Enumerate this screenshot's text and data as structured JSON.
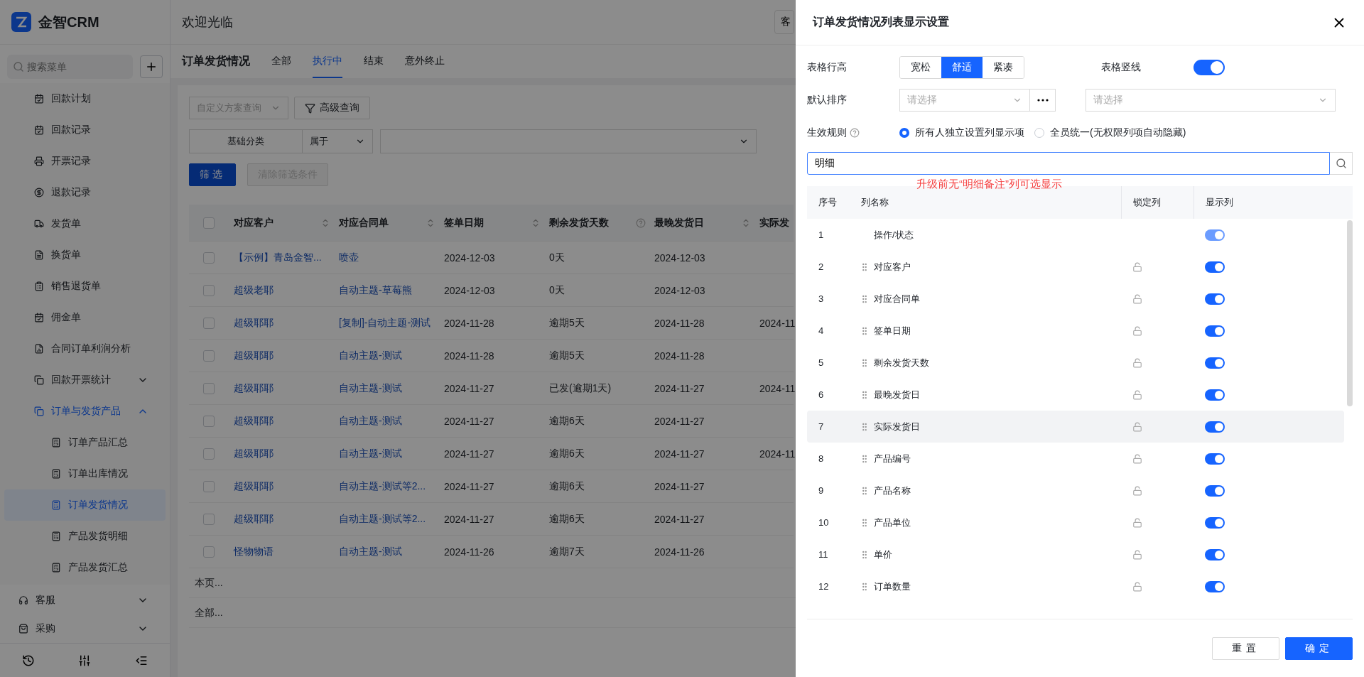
{
  "app": {
    "logo_text": "金智CRM"
  },
  "sidebar": {
    "search_placeholder": "搜索菜单",
    "sub_items": [
      {
        "label": "回款计划",
        "selected": false
      },
      {
        "label": "回款记录",
        "selected": false
      },
      {
        "label": "开票记录",
        "selected": false
      },
      {
        "label": "退款记录",
        "selected": false
      },
      {
        "label": "发货单",
        "selected": false
      },
      {
        "label": "换货单",
        "selected": false
      },
      {
        "label": "销售退货单",
        "selected": false
      },
      {
        "label": "佣金单",
        "selected": false
      },
      {
        "label": "合同订单利润分析",
        "selected": false
      },
      {
        "label": "回款开票统计",
        "expanded": false
      },
      {
        "label": "订单与发货产品",
        "expanded": true,
        "children": [
          {
            "label": "订单产品汇总",
            "selected": false
          },
          {
            "label": "订单出库情况",
            "selected": false
          },
          {
            "label": "订单发货情况",
            "selected": true
          },
          {
            "label": "产品发货明细",
            "selected": false
          },
          {
            "label": "产品发货汇总",
            "selected": false
          }
        ]
      }
    ],
    "items": [
      {
        "label": "客服",
        "expanded": false
      },
      {
        "label": "采购",
        "expanded": false
      }
    ]
  },
  "header": {
    "title": "欢迎光临",
    "button": "客"
  },
  "page": {
    "title": "订单发货情况",
    "tabs": [
      {
        "label": "全部",
        "selected": false
      },
      {
        "label": "执行中",
        "selected": true
      },
      {
        "label": "结束",
        "selected": false
      },
      {
        "label": "意外终止",
        "selected": false
      }
    ],
    "scheme_select": "自定义方案查询",
    "advanced_button": "高级查询",
    "filter": {
      "field": "基础分类",
      "operator": "属于"
    },
    "filter_button": "筛选",
    "clear_button": "清除筛选条件",
    "table": {
      "select_all": false,
      "columns": [
        {
          "label": "对应客户",
          "sortable": true,
          "help": false
        },
        {
          "label": "对应合同单",
          "sortable": true,
          "help": false
        },
        {
          "label": "签单日期",
          "sortable": true,
          "help": false
        },
        {
          "label": "剩余发货天数",
          "sortable": false,
          "help": true
        },
        {
          "label": "最晚发货日",
          "sortable": true,
          "help": false
        },
        {
          "label": "实际发"
        }
      ],
      "rows": [
        {
          "checked": false,
          "cells": [
            "【示例】青岛金智...",
            "喷壶",
            "2024-12-03",
            "0天",
            "2024-12-03",
            ""
          ]
        },
        {
          "checked": false,
          "cells": [
            "超级老耶",
            "自动主题-草莓熊",
            "2024-12-03",
            "0天",
            "2024-12-03",
            ""
          ]
        },
        {
          "checked": false,
          "cells": [
            "超级耶耶",
            "[复制]-自动主题-测试",
            "2024-11-28",
            "逾期5天",
            "2024-11-28",
            "2024-11"
          ]
        },
        {
          "checked": false,
          "cells": [
            "超级耶耶",
            "自动主题-测试",
            "2024-11-28",
            "逾期5天",
            "2024-11-28",
            ""
          ]
        },
        {
          "checked": false,
          "cells": [
            "超级耶耶",
            "自动主题-测试",
            "2024-11-27",
            "已发(逾期1天)",
            "2024-11-27",
            "2024-11"
          ]
        },
        {
          "checked": false,
          "cells": [
            "超级耶耶",
            "自动主题-测试",
            "2024-11-27",
            "逾期6天",
            "2024-11-27",
            ""
          ]
        },
        {
          "checked": false,
          "cells": [
            "超级耶耶",
            "自动主题-测试",
            "2024-11-27",
            "逾期6天",
            "2024-11-27",
            "2024-11"
          ]
        },
        {
          "checked": false,
          "cells": [
            "超级耶耶",
            "自动主题-测试等2...",
            "2024-11-27",
            "逾期6天",
            "2024-11-27",
            ""
          ]
        },
        {
          "checked": false,
          "cells": [
            "超级耶耶",
            "自动主题-测试等2...",
            "2024-11-27",
            "逾期6天",
            "2024-11-27",
            ""
          ]
        },
        {
          "checked": false,
          "cells": [
            "怪物物语",
            "自动主题-测试",
            "2024-11-26",
            "逾期7天",
            "2024-11-26",
            ""
          ]
        }
      ],
      "summary_rows": [
        "本页...",
        "全部..."
      ]
    }
  },
  "drawer": {
    "title": "订单发货情况列表显示设置",
    "row_height_label": "表格行高",
    "row_height_options": [
      {
        "label": "宽松",
        "selected": false
      },
      {
        "label": "舒适",
        "selected": true
      },
      {
        "label": "紧凑",
        "selected": false
      }
    ],
    "vertical_lines": {
      "label": "表格竖线",
      "on": true
    },
    "sort": {
      "label": "默认排序",
      "placeholder_1": "请选择",
      "placeholder_2": "请选择"
    },
    "rule": {
      "label": "生效规则",
      "options": [
        {
          "label": "所有人独立设置列显示项",
          "selected": true
        },
        {
          "label": "全员统一(无权限列项自动隐藏)",
          "selected": false
        }
      ]
    },
    "search_value": "明细",
    "annotation": "升级前无“明细备注”列可选显示",
    "table_headers": [
      "序号",
      "列名称",
      "锁定列",
      "显示列"
    ],
    "columns": [
      {
        "index": "1",
        "name": "操作/状态",
        "fixed": true,
        "shown": true,
        "hovered": false
      },
      {
        "index": "2",
        "name": "对应客户",
        "fixed": false,
        "shown": true,
        "hovered": false
      },
      {
        "index": "3",
        "name": "对应合同单",
        "fixed": false,
        "shown": true,
        "hovered": false
      },
      {
        "index": "4",
        "name": "签单日期",
        "fixed": false,
        "shown": true,
        "hovered": false
      },
      {
        "index": "5",
        "name": "剩余发货天数",
        "fixed": false,
        "shown": true,
        "hovered": false
      },
      {
        "index": "6",
        "name": "最晚发货日",
        "fixed": false,
        "shown": true,
        "hovered": false
      },
      {
        "index": "7",
        "name": "实际发货日",
        "fixed": false,
        "shown": true,
        "hovered": true
      },
      {
        "index": "8",
        "name": "产品编号",
        "fixed": false,
        "shown": true,
        "hovered": false
      },
      {
        "index": "9",
        "name": "产品名称",
        "fixed": false,
        "shown": true,
        "hovered": false
      },
      {
        "index": "10",
        "name": "产品单位",
        "fixed": false,
        "shown": true,
        "hovered": false
      },
      {
        "index": "11",
        "name": "单价",
        "fixed": false,
        "shown": true,
        "hovered": false
      },
      {
        "index": "12",
        "name": "订单数量",
        "fixed": false,
        "shown": true,
        "hovered": false
      }
    ],
    "reset_button": "重置",
    "confirm_button": "确定"
  }
}
